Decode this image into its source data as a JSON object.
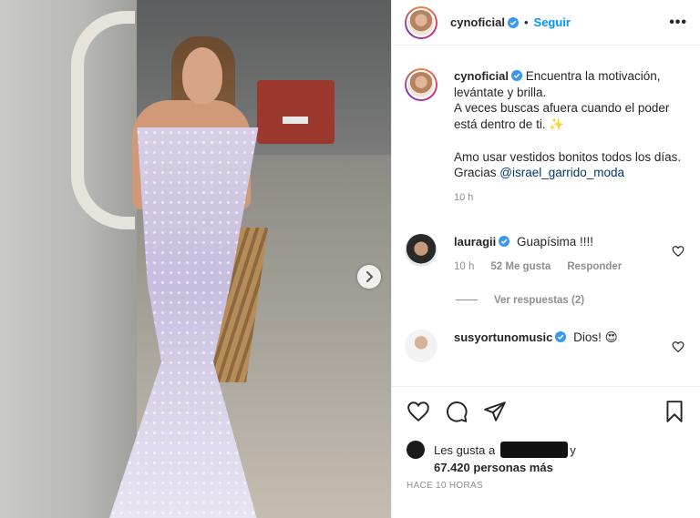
{
  "post": {
    "username": "cynoficial",
    "follow_label": "Seguir",
    "dot": "•",
    "more_label": "•••",
    "caption": "Encuentra la motivación, levántate y brilla.\nA veces buscas afuera cuando el poder está dentro de ti. ✨\n\nAmo usar vestidos bonitos todos los días.\nGracias ",
    "caption_mention": "@israel_garrido_moda",
    "caption_time": "10 h"
  },
  "comments": [
    {
      "username": "lauragii",
      "text": "Guapísima !!!!",
      "time": "10 h",
      "likes": "52 Me gusta",
      "reply_label": "Responder",
      "view_replies": "Ver respuestas (2)"
    },
    {
      "username": "susyortunomusic",
      "text": "Dios! 😍",
      "time": "",
      "likes": "",
      "reply_label": ""
    }
  ],
  "likes": {
    "prefix": "Les gusta a",
    "tail": "y",
    "count_line": "67.420 personas más"
  },
  "timestamp": "HACE 10 HORAS",
  "colors": {
    "accent": "#0095f6",
    "verified": "#3897f0",
    "muted": "#8e8e8e",
    "text": "#262626"
  },
  "icons": {
    "next": "chevron-right-icon",
    "like": "heart-icon",
    "comment": "comment-icon",
    "share": "paper-plane-icon",
    "save": "bookmark-icon"
  }
}
